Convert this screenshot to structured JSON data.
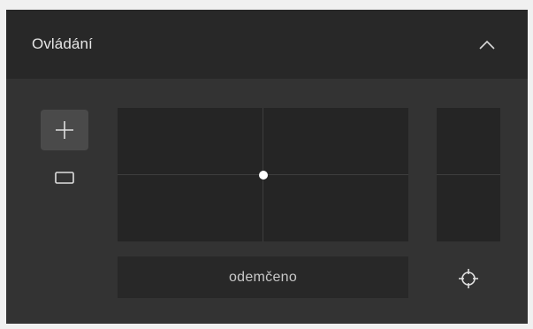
{
  "panel": {
    "title": "Ovládání",
    "collapse_icon": "chevron-up-icon"
  },
  "tools": {
    "add_icon": "plus-icon",
    "rect_icon": "rectangle-icon"
  },
  "xy_pad": {
    "handle_x": 0.5,
    "handle_y": 0.5
  },
  "lock": {
    "label": "odemčeno"
  },
  "target": {
    "icon": "crosshair-icon"
  },
  "colors": {
    "panel_bg": "#333333",
    "header_bg": "#282828",
    "pad_bg": "#252525",
    "text": "#e6e6e6",
    "handle": "#ffffff"
  }
}
